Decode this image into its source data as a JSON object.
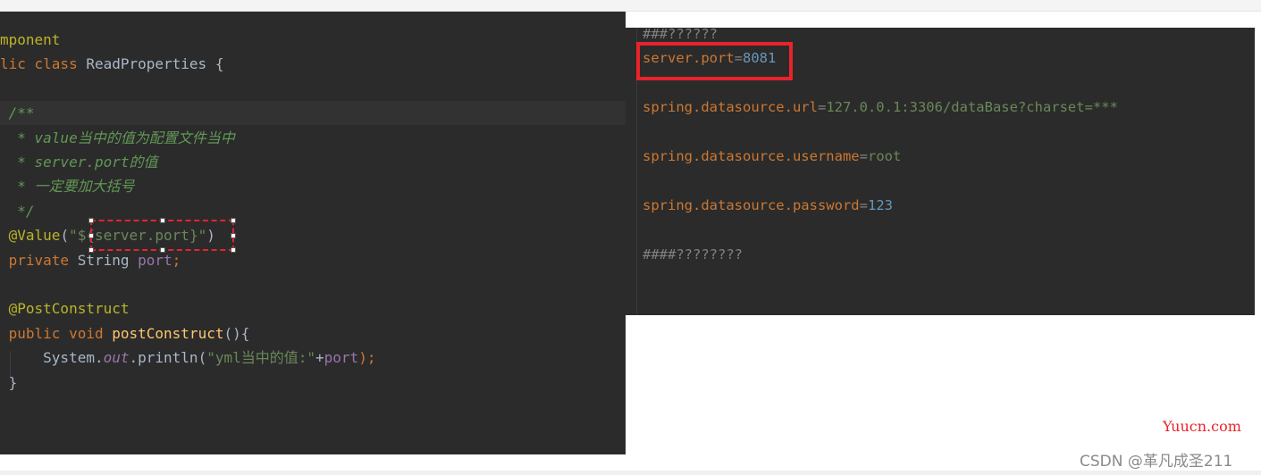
{
  "java_editor": {
    "lines": [
      [
        {
          "t": "mponent",
          "c": "ann"
        }
      ],
      [
        {
          "t": "lic class ",
          "c": "kw"
        },
        {
          "t": "ReadProperties {",
          "c": "plain"
        }
      ],
      [],
      [
        {
          "t": " /**",
          "c": "doc"
        }
      ],
      [
        {
          "t": "  * value当中的值为配置文件当中",
          "c": "doc"
        }
      ],
      [
        {
          "t": "  * server.port的值",
          "c": "doc"
        }
      ],
      [
        {
          "t": "  * 一定要加大括号",
          "c": "doc"
        }
      ],
      [
        {
          "t": "  */",
          "c": "doc"
        }
      ],
      [
        {
          "t": " @Value",
          "c": "ann"
        },
        {
          "t": "(",
          "c": "plain"
        },
        {
          "t": "\"${server.port}\"",
          "c": "str"
        },
        {
          "t": ")",
          "c": "plain"
        }
      ],
      [
        {
          "t": " private ",
          "c": "kw"
        },
        {
          "t": "String ",
          "c": "plain"
        },
        {
          "t": "port",
          "c": "field"
        },
        {
          "t": ";",
          "c": "kw"
        }
      ],
      [],
      [
        {
          "t": " @PostConstruct",
          "c": "ann"
        }
      ],
      [
        {
          "t": " public void ",
          "c": "kw"
        },
        {
          "t": "postConstruct",
          "c": "method"
        },
        {
          "t": "(){",
          "c": "plain"
        }
      ],
      [
        {
          "t": "     System.",
          "c": "plain"
        },
        {
          "t": "out",
          "c": "static"
        },
        {
          "t": ".println(",
          "c": "plain"
        },
        {
          "t": "\"yml当中的值:\"",
          "c": "str"
        },
        {
          "t": "+",
          "c": "plain"
        },
        {
          "t": "port",
          "c": "field"
        },
        {
          "t": ");",
          "c": "kw"
        }
      ],
      [
        {
          "t": " }",
          "c": "plain"
        }
      ]
    ]
  },
  "properties_editor": {
    "lines": [
      [
        {
          "t": "###??????",
          "c": "pcom"
        }
      ],
      [
        {
          "t": "server.port",
          "c": "pkey"
        },
        {
          "t": "=",
          "c": "peq"
        },
        {
          "t": "8081",
          "c": "pnum"
        }
      ],
      [
        {
          "t": "spring.datasource.url",
          "c": "pkey"
        },
        {
          "t": "=",
          "c": "peq"
        },
        {
          "t": "127.0.0.1:3306/dataBase?charset=***",
          "c": "pval"
        }
      ],
      [
        {
          "t": "spring.datasource.username",
          "c": "pkey"
        },
        {
          "t": "=",
          "c": "peq"
        },
        {
          "t": "root",
          "c": "pval"
        }
      ],
      [
        {
          "t": "spring.datasource.password",
          "c": "pkey"
        },
        {
          "t": "=",
          "c": "peq"
        },
        {
          "t": "123",
          "c": "pnum"
        }
      ],
      [
        {
          "t": "####????????",
          "c": "pcom"
        }
      ]
    ]
  },
  "watermarks": {
    "site": "Yuucn.com",
    "author": "CSDN @革凡成圣211"
  },
  "colors": {
    "editor_bg": "#2b2b2b",
    "highlight_red": "#e8232b"
  }
}
